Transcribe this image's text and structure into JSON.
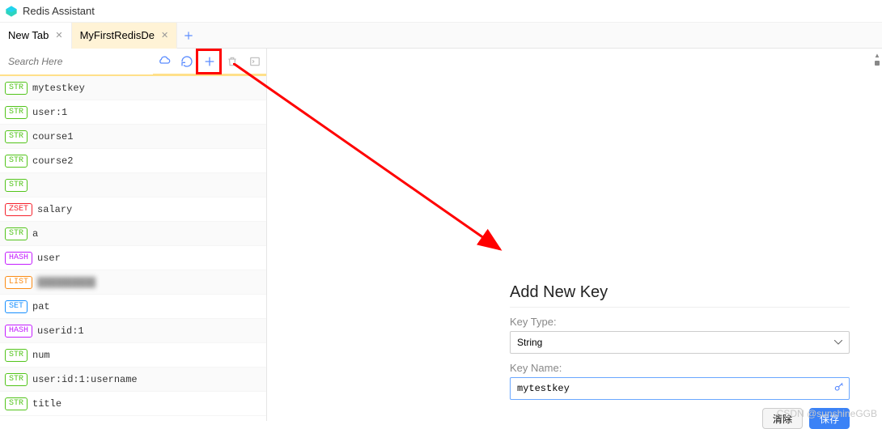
{
  "app": {
    "title": "Redis Assistant"
  },
  "tabs": [
    {
      "label": "New Tab",
      "active": false
    },
    {
      "label": "MyFirstRedisDe",
      "active": true
    }
  ],
  "search": {
    "placeholder": "Search Here"
  },
  "keys": [
    {
      "type": "STR",
      "name": "mytestkey"
    },
    {
      "type": "STR",
      "name": "user:1"
    },
    {
      "type": "STR",
      "name": "course1"
    },
    {
      "type": "STR",
      "name": "course2"
    },
    {
      "type": "STR",
      "name": ""
    },
    {
      "type": "ZSET",
      "name": "salary"
    },
    {
      "type": "STR",
      "name": "a"
    },
    {
      "type": "HASH",
      "name": "user"
    },
    {
      "type": "LIST",
      "name": "hidden",
      "blurred": true
    },
    {
      "type": "SET",
      "name": "pat"
    },
    {
      "type": "HASH",
      "name": "userid:1"
    },
    {
      "type": "STR",
      "name": "num"
    },
    {
      "type": "STR",
      "name": "user:id:1:username"
    },
    {
      "type": "STR",
      "name": "title"
    }
  ],
  "panel": {
    "title": "Add New Key",
    "type_label": "Key Type:",
    "type_value": "String",
    "name_label": "Key Name:",
    "name_value": "mytestkey",
    "clear_btn": "清除",
    "save_btn": "保存"
  },
  "watermark": "CSDN @sunshineGGB"
}
